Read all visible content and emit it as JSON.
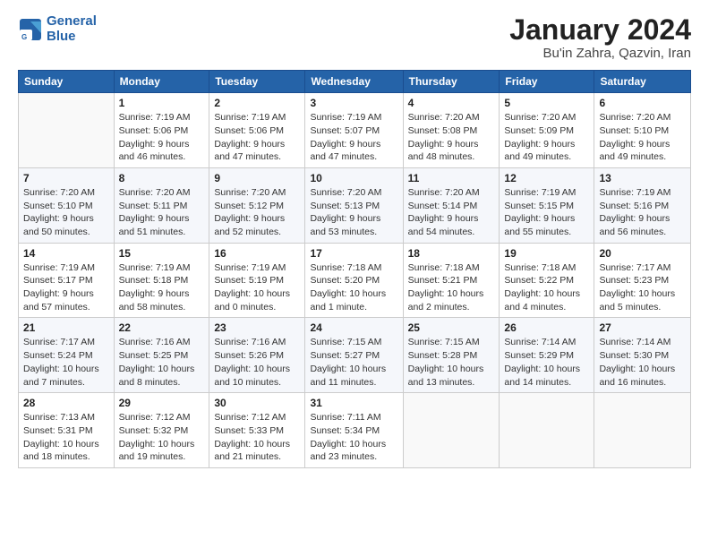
{
  "header": {
    "logo_line1": "General",
    "logo_line2": "Blue",
    "title": "January 2024",
    "subtitle": "Bu'in Zahra, Qazvin, Iran"
  },
  "days_of_week": [
    "Sunday",
    "Monday",
    "Tuesday",
    "Wednesday",
    "Thursday",
    "Friday",
    "Saturday"
  ],
  "weeks": [
    [
      {
        "day": "",
        "info": ""
      },
      {
        "day": "1",
        "info": "Sunrise: 7:19 AM\nSunset: 5:06 PM\nDaylight: 9 hours\nand 46 minutes."
      },
      {
        "day": "2",
        "info": "Sunrise: 7:19 AM\nSunset: 5:06 PM\nDaylight: 9 hours\nand 47 minutes."
      },
      {
        "day": "3",
        "info": "Sunrise: 7:19 AM\nSunset: 5:07 PM\nDaylight: 9 hours\nand 47 minutes."
      },
      {
        "day": "4",
        "info": "Sunrise: 7:20 AM\nSunset: 5:08 PM\nDaylight: 9 hours\nand 48 minutes."
      },
      {
        "day": "5",
        "info": "Sunrise: 7:20 AM\nSunset: 5:09 PM\nDaylight: 9 hours\nand 49 minutes."
      },
      {
        "day": "6",
        "info": "Sunrise: 7:20 AM\nSunset: 5:10 PM\nDaylight: 9 hours\nand 49 minutes."
      }
    ],
    [
      {
        "day": "7",
        "info": "Sunrise: 7:20 AM\nSunset: 5:10 PM\nDaylight: 9 hours\nand 50 minutes."
      },
      {
        "day": "8",
        "info": "Sunrise: 7:20 AM\nSunset: 5:11 PM\nDaylight: 9 hours\nand 51 minutes."
      },
      {
        "day": "9",
        "info": "Sunrise: 7:20 AM\nSunset: 5:12 PM\nDaylight: 9 hours\nand 52 minutes."
      },
      {
        "day": "10",
        "info": "Sunrise: 7:20 AM\nSunset: 5:13 PM\nDaylight: 9 hours\nand 53 minutes."
      },
      {
        "day": "11",
        "info": "Sunrise: 7:20 AM\nSunset: 5:14 PM\nDaylight: 9 hours\nand 54 minutes."
      },
      {
        "day": "12",
        "info": "Sunrise: 7:19 AM\nSunset: 5:15 PM\nDaylight: 9 hours\nand 55 minutes."
      },
      {
        "day": "13",
        "info": "Sunrise: 7:19 AM\nSunset: 5:16 PM\nDaylight: 9 hours\nand 56 minutes."
      }
    ],
    [
      {
        "day": "14",
        "info": "Sunrise: 7:19 AM\nSunset: 5:17 PM\nDaylight: 9 hours\nand 57 minutes."
      },
      {
        "day": "15",
        "info": "Sunrise: 7:19 AM\nSunset: 5:18 PM\nDaylight: 9 hours\nand 58 minutes."
      },
      {
        "day": "16",
        "info": "Sunrise: 7:19 AM\nSunset: 5:19 PM\nDaylight: 10 hours\nand 0 minutes."
      },
      {
        "day": "17",
        "info": "Sunrise: 7:18 AM\nSunset: 5:20 PM\nDaylight: 10 hours\nand 1 minute."
      },
      {
        "day": "18",
        "info": "Sunrise: 7:18 AM\nSunset: 5:21 PM\nDaylight: 10 hours\nand 2 minutes."
      },
      {
        "day": "19",
        "info": "Sunrise: 7:18 AM\nSunset: 5:22 PM\nDaylight: 10 hours\nand 4 minutes."
      },
      {
        "day": "20",
        "info": "Sunrise: 7:17 AM\nSunset: 5:23 PM\nDaylight: 10 hours\nand 5 minutes."
      }
    ],
    [
      {
        "day": "21",
        "info": "Sunrise: 7:17 AM\nSunset: 5:24 PM\nDaylight: 10 hours\nand 7 minutes."
      },
      {
        "day": "22",
        "info": "Sunrise: 7:16 AM\nSunset: 5:25 PM\nDaylight: 10 hours\nand 8 minutes."
      },
      {
        "day": "23",
        "info": "Sunrise: 7:16 AM\nSunset: 5:26 PM\nDaylight: 10 hours\nand 10 minutes."
      },
      {
        "day": "24",
        "info": "Sunrise: 7:15 AM\nSunset: 5:27 PM\nDaylight: 10 hours\nand 11 minutes."
      },
      {
        "day": "25",
        "info": "Sunrise: 7:15 AM\nSunset: 5:28 PM\nDaylight: 10 hours\nand 13 minutes."
      },
      {
        "day": "26",
        "info": "Sunrise: 7:14 AM\nSunset: 5:29 PM\nDaylight: 10 hours\nand 14 minutes."
      },
      {
        "day": "27",
        "info": "Sunrise: 7:14 AM\nSunset: 5:30 PM\nDaylight: 10 hours\nand 16 minutes."
      }
    ],
    [
      {
        "day": "28",
        "info": "Sunrise: 7:13 AM\nSunset: 5:31 PM\nDaylight: 10 hours\nand 18 minutes."
      },
      {
        "day": "29",
        "info": "Sunrise: 7:12 AM\nSunset: 5:32 PM\nDaylight: 10 hours\nand 19 minutes."
      },
      {
        "day": "30",
        "info": "Sunrise: 7:12 AM\nSunset: 5:33 PM\nDaylight: 10 hours\nand 21 minutes."
      },
      {
        "day": "31",
        "info": "Sunrise: 7:11 AM\nSunset: 5:34 PM\nDaylight: 10 hours\nand 23 minutes."
      },
      {
        "day": "",
        "info": ""
      },
      {
        "day": "",
        "info": ""
      },
      {
        "day": "",
        "info": ""
      }
    ]
  ]
}
